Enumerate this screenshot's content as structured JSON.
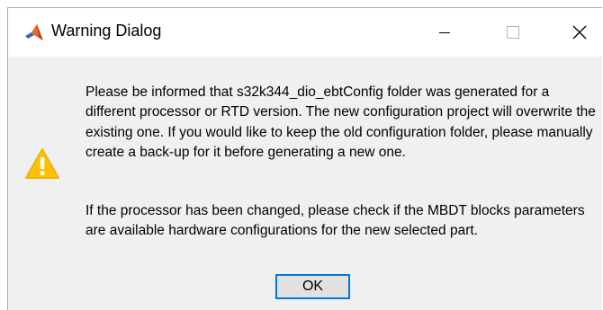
{
  "window": {
    "title": "Warning Dialog",
    "icon": "matlab-icon"
  },
  "title_controls": {
    "minimize_icon": "minimize-icon",
    "maximize_icon": "maximize-icon",
    "close_icon": "close-icon"
  },
  "message": {
    "icon": "warning-icon",
    "paragraph1": "Please be informed that s32k344_dio_ebtConfig folder was generated for a different processor or RTD version. The new configuration project will overwrite the existing one. If you would like to keep the old configuration folder, please manually create a back-up for it before generating a new one.",
    "paragraph2": "If the processor has been changed, please check if the MBDT blocks parameters are available hardware configurations for the new selected part."
  },
  "buttons": {
    "ok_label": "OK"
  },
  "colors": {
    "accent": "#0078d7",
    "warning": "#ffc107",
    "dialog_background": "#f0f0f0"
  }
}
